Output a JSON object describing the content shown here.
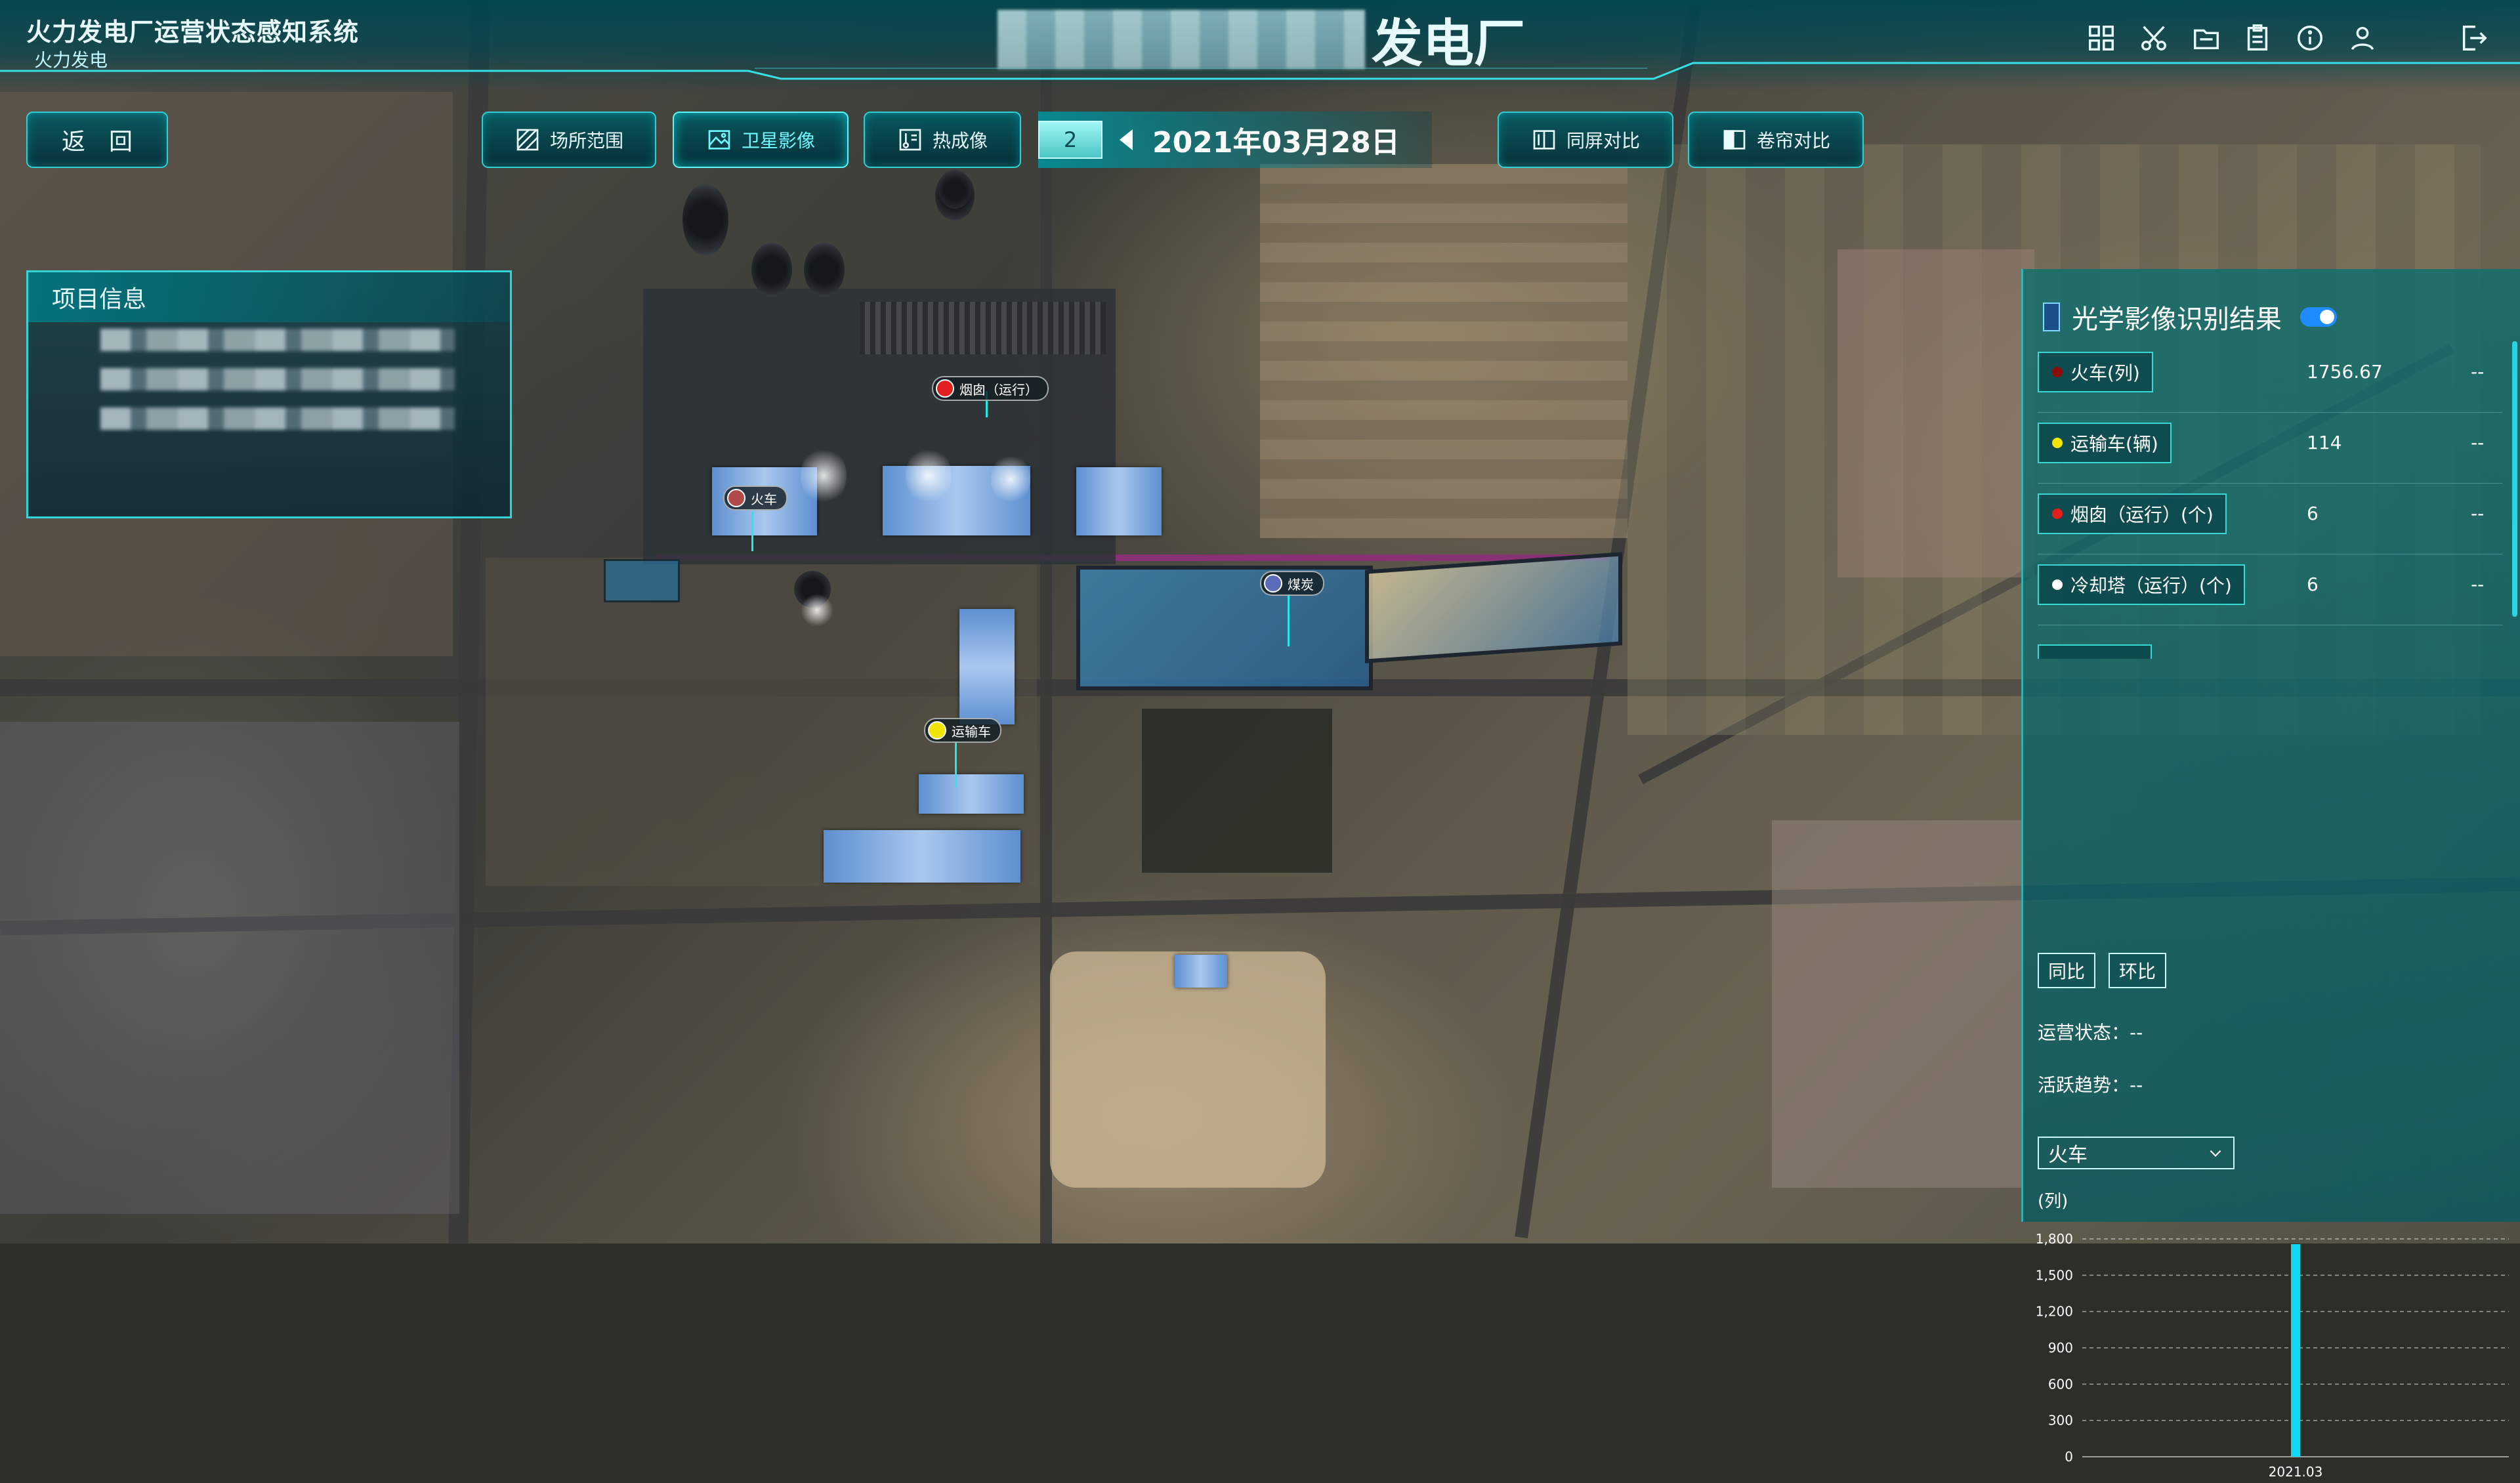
{
  "header": {
    "system_title": "火力发电厂运营状态感知系统",
    "system_subtitle": "火力发电",
    "plant_name_suffix": "发电厂",
    "icons": [
      "grid-icon",
      "scissors-icon",
      "folder-icon",
      "clipboard-icon",
      "info-icon",
      "user-icon",
      "logout-icon"
    ]
  },
  "toolbar": {
    "back_label": "返　回",
    "site_range_label": "场所范围",
    "satellite_label": "卫星影像",
    "thermal_label": "热成像",
    "screen_compare_label": "同屏对比",
    "curtain_compare_label": "卷帘对比",
    "date_badge": "2",
    "date_text": "2021年03月28日"
  },
  "project_panel": {
    "title": "项目信息"
  },
  "map_markers": {
    "chimney": "烟囱（运行）",
    "train": "火车",
    "coal": "煤炭",
    "truck": "运输车"
  },
  "results_panel": {
    "title": "光学影像识别结果",
    "rows": [
      {
        "label": "火车(列)",
        "value": "1756.67",
        "trend": "--",
        "color": "#8b0c0c"
      },
      {
        "label": "运输车(辆)",
        "value": "114",
        "trend": "--",
        "color": "#f2e600"
      },
      {
        "label": "烟囱（运行）(个)",
        "value": "6",
        "trend": "--",
        "color": "#e41d1d"
      },
      {
        "label": "冷却塔（运行）(个)",
        "value": "6",
        "trend": "--",
        "color": "#ffffff"
      }
    ],
    "yoy_label": "同比",
    "mom_label": "环比",
    "status_label": "运营状态：--",
    "trend_label": "活跃趋势：--",
    "select_value": "火车",
    "unit": "(列)"
  },
  "chart_data": {
    "type": "bar",
    "categories": [
      "2021.03"
    ],
    "values": [
      1756.67
    ],
    "ylim": [
      0,
      1800
    ],
    "yticks": [
      0,
      300,
      600,
      900,
      1200,
      1500,
      1800
    ],
    "ytick_labels": [
      "0",
      "300",
      "600",
      "900",
      "1,200",
      "1,500",
      "1,800"
    ],
    "grid": true,
    "bar_color": "#12d8f5"
  }
}
